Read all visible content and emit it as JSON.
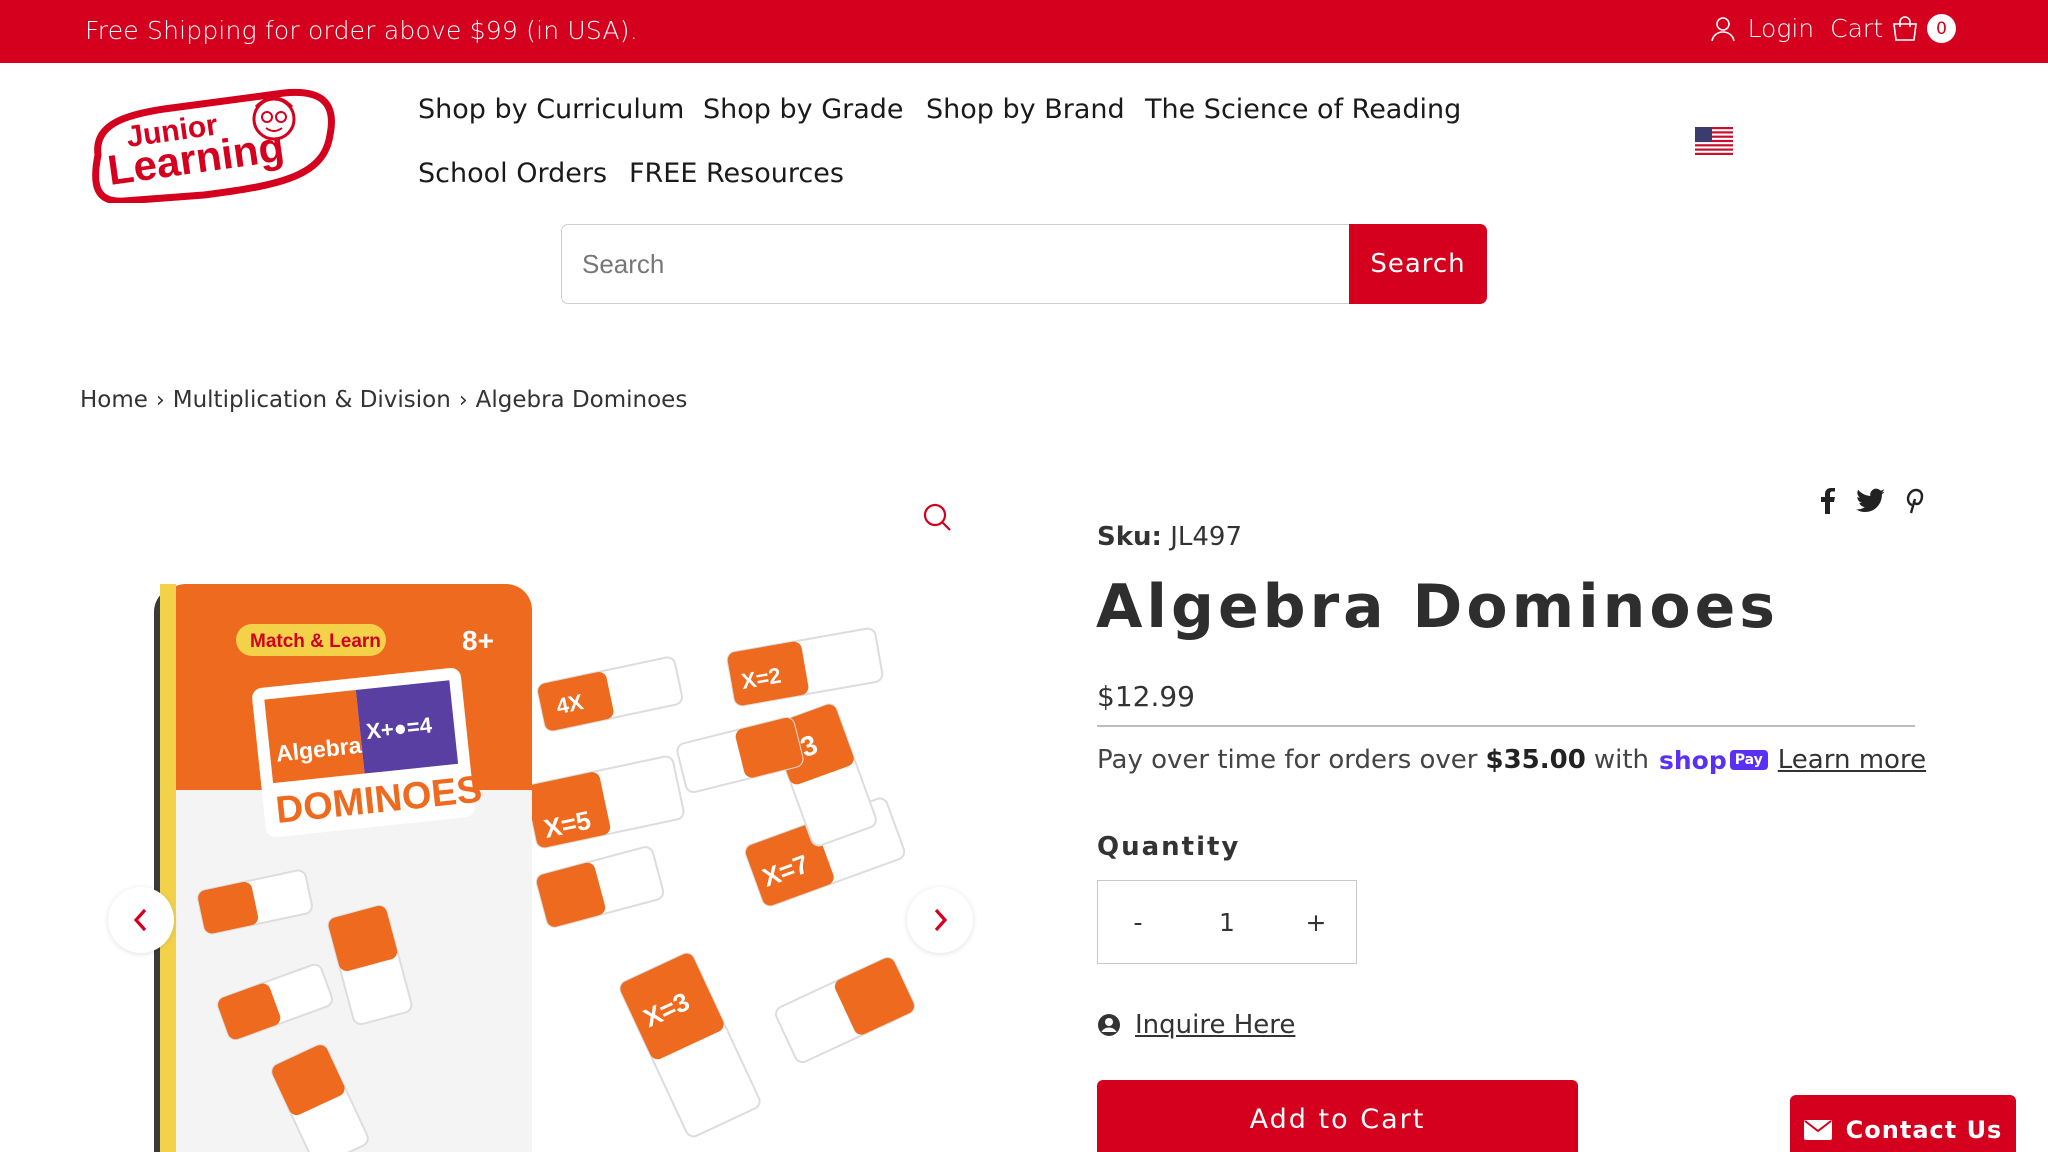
{
  "topbar": {
    "promo": "Free Shipping for order above $99 (in USA).",
    "login": "Login",
    "cart": "Cart",
    "cart_count": "0"
  },
  "logo": {
    "line1": "Junior",
    "line2": "Learning"
  },
  "nav": {
    "items": [
      "Shop by Curriculum",
      "Shop by Grade",
      "Shop by Brand",
      "The Science of Reading",
      "School Orders",
      "FREE Resources"
    ]
  },
  "search": {
    "placeholder": "Search",
    "button": "Search"
  },
  "breadcrumb": {
    "home": "Home",
    "category": "Multiplication & Division",
    "current": "Algebra Dominoes"
  },
  "product": {
    "sku_label": "Sku:",
    "sku": "JL497",
    "title": "Algebra Dominoes",
    "price": "$12.99",
    "installments_text": "Pay over time for orders over",
    "installments_amount": "$35.00",
    "installments_with": "with",
    "shoppay": "shop",
    "shoppay_badge": "Pay",
    "learn_more": "Learn more",
    "quantity_label": "Quantity",
    "quantity_minus": "-",
    "quantity": "1",
    "quantity_plus": "+",
    "inquire": "Inquire Here",
    "add_to_cart": "Add to Cart"
  },
  "image": {
    "brand_tag": "Match & Learn",
    "age": "8+",
    "box_title_top": "Algebra",
    "box_title": "DOMINOES",
    "box_equation": "X+●=4",
    "tiles": [
      "X=5",
      "X=7",
      "X=2",
      "3",
      "4X",
      "X=3"
    ]
  },
  "contact": {
    "label": "Contact Us"
  },
  "colors": {
    "brand_red": "#d4001e",
    "shoppay_purple": "#5a31f4",
    "tile_orange": "#ee6a1e"
  }
}
